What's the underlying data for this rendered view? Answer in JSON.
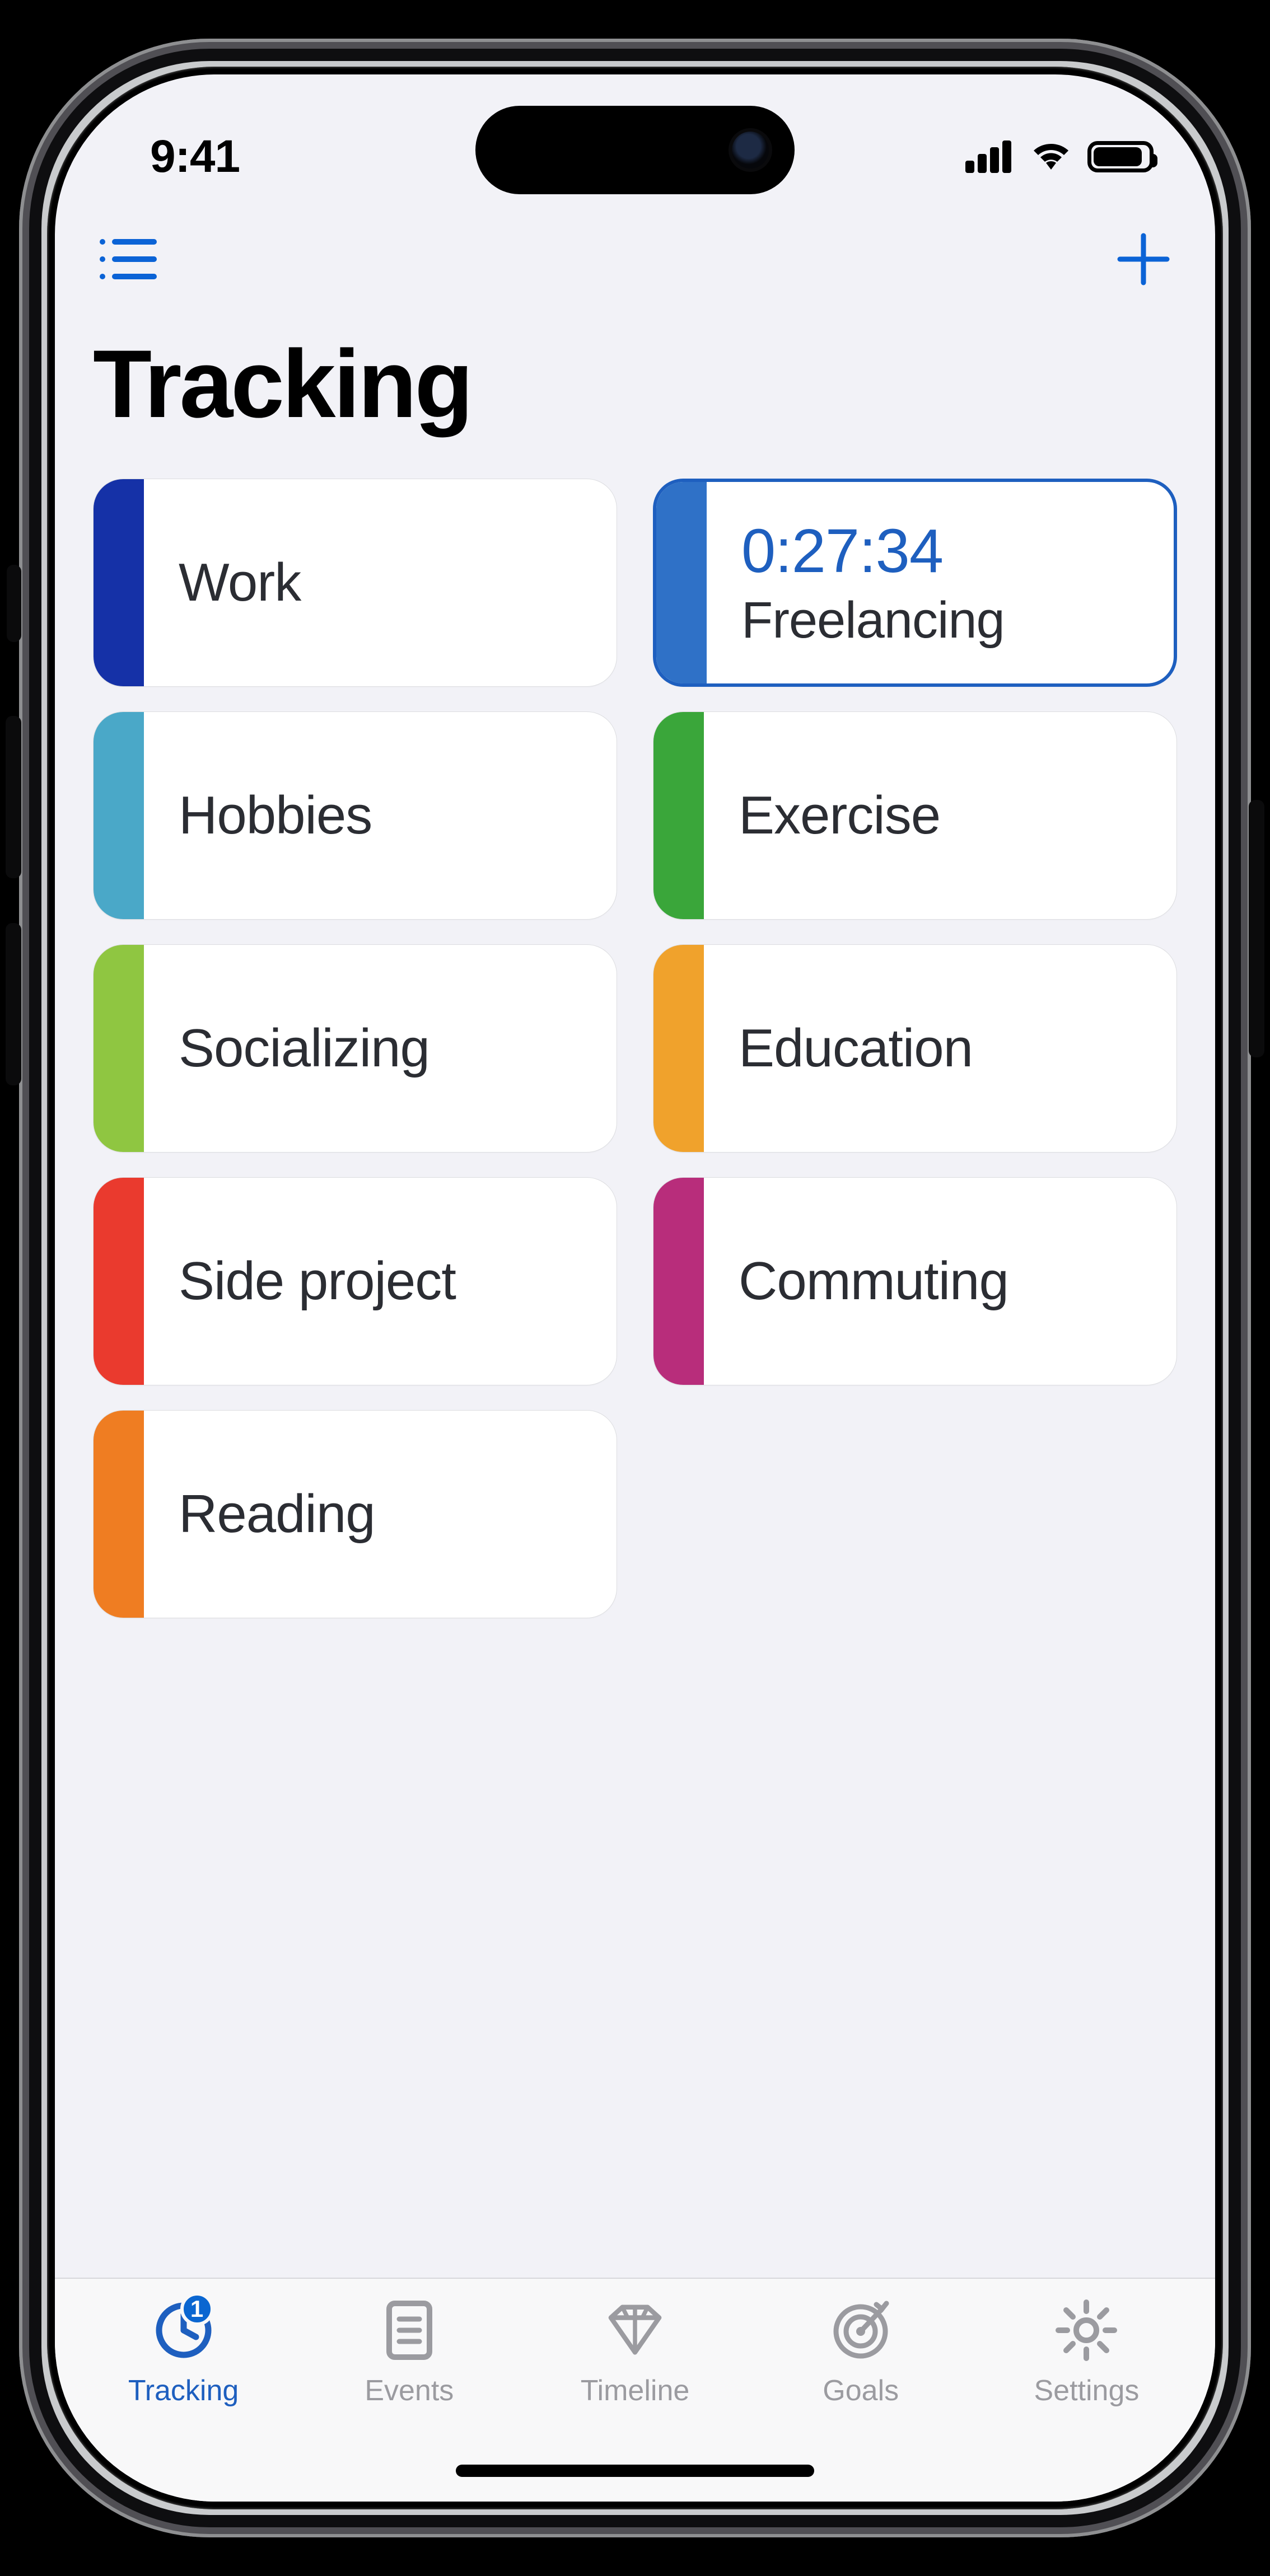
{
  "status": {
    "time": "9:41"
  },
  "page": {
    "title": "Tracking"
  },
  "active_card": {
    "timer": "0:27:34",
    "label": "Freelancing",
    "stripe_color": "#2f71c7"
  },
  "cards": [
    {
      "label": "Work",
      "stripe_color": "#1531a7"
    },
    {
      "label": "Hobbies",
      "stripe_color": "#4aa8c8"
    },
    {
      "label": "Exercise",
      "stripe_color": "#3aa63a"
    },
    {
      "label": "Socializing",
      "stripe_color": "#8fc641"
    },
    {
      "label": "Education",
      "stripe_color": "#f0a22c"
    },
    {
      "label": "Side project",
      "stripe_color": "#ea3a2e"
    },
    {
      "label": "Commuting",
      "stripe_color": "#b82d7b"
    },
    {
      "label": "Reading",
      "stripe_color": "#ef7d22"
    }
  ],
  "tabs": {
    "tracking": {
      "label": "Tracking",
      "badge": "1"
    },
    "events": {
      "label": "Events"
    },
    "timeline": {
      "label": "Timeline"
    },
    "goals": {
      "label": "Goals"
    },
    "settings": {
      "label": "Settings"
    }
  }
}
